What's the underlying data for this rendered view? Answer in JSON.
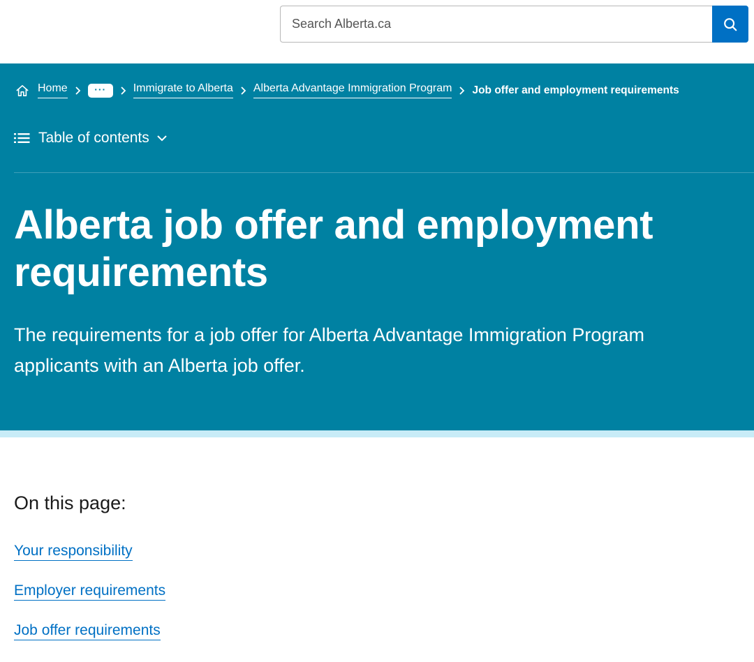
{
  "search": {
    "placeholder": "Search Alberta.ca"
  },
  "breadcrumb": {
    "home": "Home",
    "ellipsis": "···",
    "items": [
      "Immigrate to Alberta",
      "Alberta Advantage Immigration Program"
    ],
    "current": "Job offer and employment requirements"
  },
  "toc": {
    "label": "Table of contents"
  },
  "hero": {
    "title": "Alberta job offer and employment requirements",
    "lead": "The requirements for a job offer for Alberta Advantage Immigration Program applicants with an Alberta job offer."
  },
  "on_this_page": {
    "heading": "On this page:",
    "links": [
      "Your responsibility",
      "Employer requirements",
      "Job offer requirements"
    ]
  },
  "colors": {
    "hero_bg": "#0081a2",
    "hero_stripe": "#c8ecf7",
    "link": "#0070c4",
    "search_button": "#0070c4"
  },
  "icons": {
    "search": "search-icon",
    "home": "home-icon",
    "separator": "chevron-right-icon",
    "toc": "list-icon",
    "toc_toggle": "chevron-down-icon"
  }
}
